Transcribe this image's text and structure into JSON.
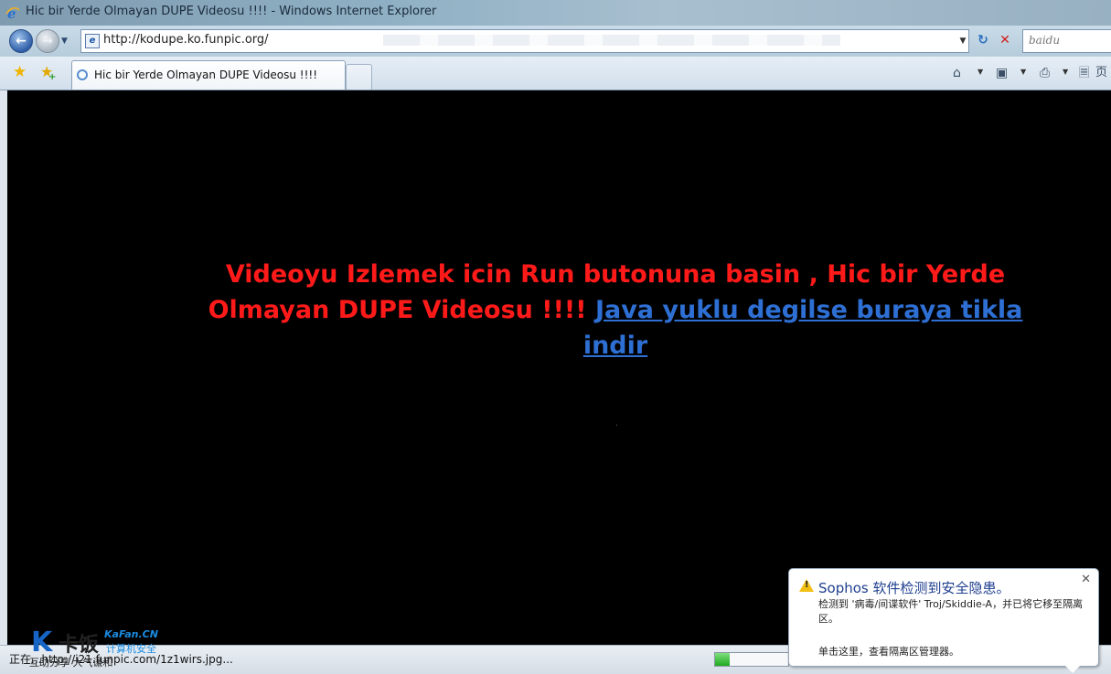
{
  "window": {
    "title": "Hic bir Yerde Olmayan DUPE Videosu !!!! - Windows Internet Explorer"
  },
  "address_bar": {
    "url": "http://kodupe.ko.funpic.org/",
    "search_value": "baidu"
  },
  "tabs": [
    {
      "label": "Hic bir Yerde Olmayan DUPE Videosu !!!!"
    }
  ],
  "toolbar_icons": [
    "favorites-star-icon",
    "add-favorites-icon",
    "home-icon",
    "feeds-icon",
    "print-icon",
    "page-icon"
  ],
  "toolbar": {
    "page_label": "页"
  },
  "page": {
    "message_red": "Videoyu Izlemek icin Run butonuna basin , Hic bir Yerde Olmayan DUPE Videosu !!!!",
    "message_link": "Java yuklu degilse buraya tikla indir",
    "message_color": "#ff1a1a",
    "link_color": "#2e6fd4"
  },
  "status_bar": {
    "text": "正在...http://i21.funpic.com/1z1wirs.jpg...",
    "progress": 0.2
  },
  "watermark": {
    "brand": "卡饭",
    "brand_en": "KaFan.CN",
    "subtitle": "计算机安全",
    "tagline": "互助分享 大气谦和"
  },
  "notification": {
    "title": "Sophos 软件检测到安全隐患。",
    "body": "检测到 '病毒/间谍软件' Troj/Skiddie-A，并已将它移至隔离区。",
    "footer": "单击这里，查看隔离区管理器。"
  }
}
